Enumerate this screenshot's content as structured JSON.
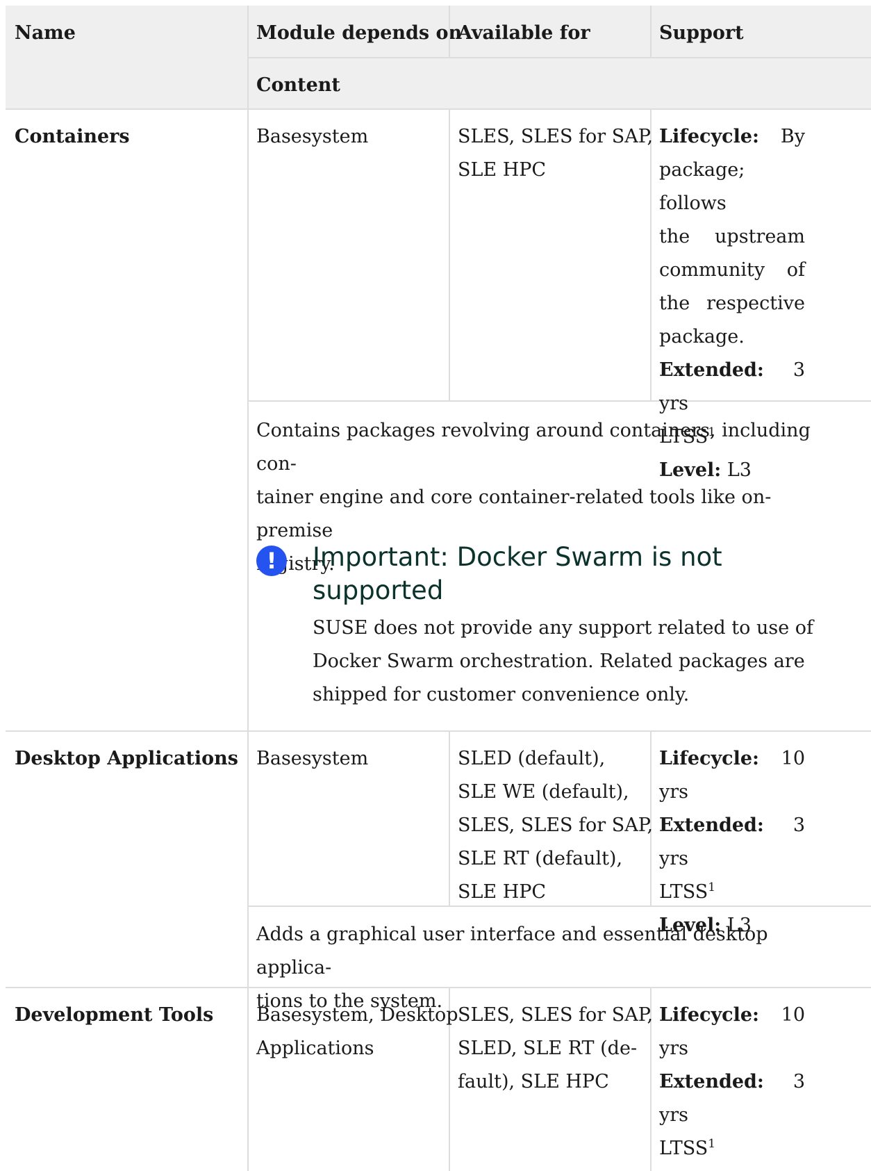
{
  "header": {
    "name": "Name",
    "depends": "Module depends on",
    "available": "Available for",
    "support": "Support",
    "content": "Content"
  },
  "rows": [
    {
      "name": "Containers",
      "depends": "Basesystem",
      "available": [
        "SLES, SLES for SAP,",
        "SLE HPC"
      ],
      "support": {
        "lifecycle_label": "Lifecycle:",
        "lifecycle_lines": [
          "By",
          "package; follows",
          "the upstream",
          "community of",
          "the respective",
          "package."
        ],
        "extended_label": "Extended:",
        "extended_value": "3 yrs",
        "ltss": "LTSS",
        "footnote": "1",
        "level_label": "Level:",
        "level_value": "L3"
      },
      "content": [
        "Contains packages revolving around containers, including con-",
        "tainer engine and core container-related tools like on-premise",
        "registry."
      ],
      "important": {
        "icon": "exclamation-icon",
        "title_lines": [
          "Important: Docker Swarm is not",
          "supported"
        ],
        "body_lines": [
          "SUSE does not provide any support related to use of",
          "Docker Swarm orchestration. Related packages are",
          "shipped for customer convenience only."
        ]
      }
    },
    {
      "name": "Desktop Applications",
      "depends": "Basesystem",
      "available": [
        "SLED (default),",
        "SLE WE (default),",
        "SLES, SLES for SAP,",
        "SLE RT (default),",
        "SLE HPC"
      ],
      "support": {
        "lifecycle_label": "Lifecycle:",
        "lifecycle_value": "10 yrs",
        "extended_label": "Extended:",
        "extended_value": "3 yrs",
        "ltss": "LTSS",
        "footnote": "1",
        "level_label": "Level:",
        "level_value": "L3"
      },
      "content": [
        "Adds a graphical user interface and essential desktop applica-",
        "tions to the system."
      ]
    },
    {
      "name": "Development Tools",
      "depends": [
        "Basesystem, Desktop",
        "Applications"
      ],
      "available": [
        "SLES, SLES for SAP,",
        "SLED, SLE RT (de-",
        "fault), SLE HPC"
      ],
      "support": {
        "lifecycle_label": "Lifecycle:",
        "lifecycle_value": "10 yrs",
        "extended_label": "Extended:",
        "extended_value": "3 yrs",
        "ltss": "LTSS",
        "footnote": "1"
      }
    }
  ],
  "colors": {
    "header_bg": "#efefef",
    "rule": "#dddddd",
    "icon": "#2453f0",
    "title": "#0c322c"
  }
}
